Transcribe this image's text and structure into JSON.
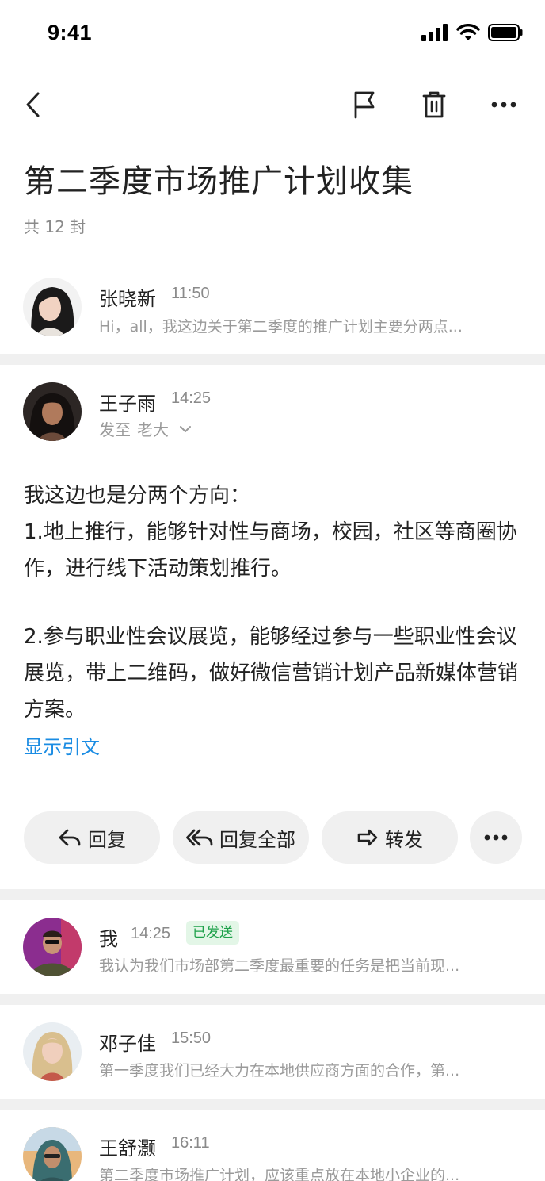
{
  "status": {
    "time": "9:41"
  },
  "thread": {
    "title": "第二季度市场推广计划收集",
    "count": "共 12 封"
  },
  "messages": [
    {
      "name": "张晓新",
      "time": "11:50",
      "preview": "Hi，all，我这边关于第二季度的推广计划主要分两点..."
    },
    {
      "name": "王子雨",
      "time": "14:25",
      "to_label": "发至",
      "to_name": "老大",
      "body": [
        "我这边也是分两个方向：",
        "1.地上推行，能够针对性与商场，校园，社区等商圈协作，进行线下活动策划推行。",
        "2.参与职业性会议展览，能够经过参与一些职业性会议展览，带上二维码，做好微信营销计划产品新媒体营销方案。"
      ],
      "show_quote": "显示引文"
    },
    {
      "name": "我",
      "time": "14:25",
      "badge": "已发送",
      "preview": "我认为我们市场部第二季度最重要的任务是把当前现..."
    },
    {
      "name": "邓子佳",
      "time": "15:50",
      "preview": "第一季度我们已经大力在本地供应商方面的合作，第..."
    },
    {
      "name": "王舒灏",
      "time": "16:11",
      "preview": "第二季度市场推广计划，应该重点放在本地小企业的..."
    }
  ],
  "actions": {
    "reply": "回复",
    "reply_all": "回复全部",
    "forward": "转发"
  },
  "icons": {
    "back": "back-chevron-icon",
    "flag": "flag-icon",
    "trash": "trash-icon",
    "more": "more-dots-icon"
  },
  "colors": {
    "link": "#1a8ce3",
    "badge_bg": "#e3f6e7",
    "badge_text": "#1ea14a",
    "divider": "#f0f0f0"
  }
}
